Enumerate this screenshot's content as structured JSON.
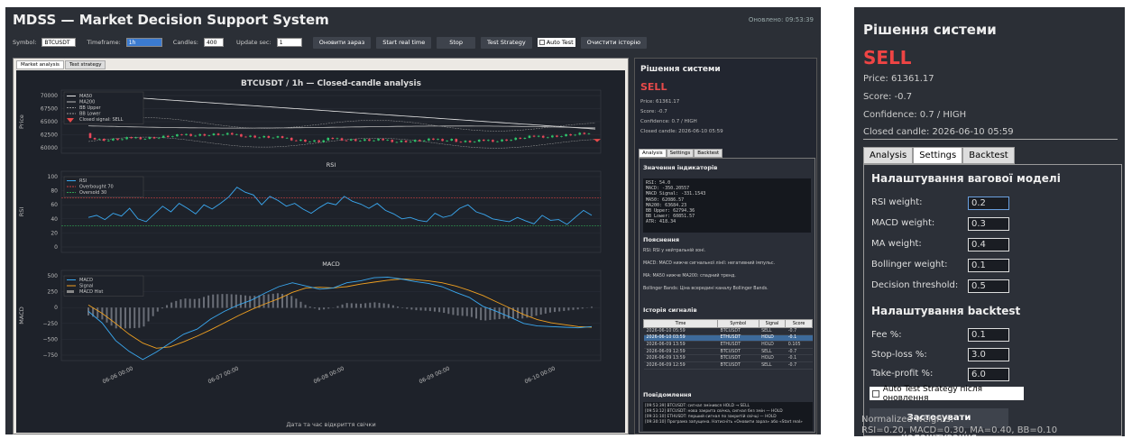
{
  "app": {
    "title": "MDSS — Market Decision Support System",
    "status": "Оновлено: 09:53:39"
  },
  "toolbar": {
    "symbol_label": "Symbol:",
    "symbol_value": "BTCUSDT",
    "timeframe_label": "Timeframe:",
    "timeframe_value": "1h",
    "candles_label": "Candles:",
    "candles_value": "400",
    "update_label": "Update sec:",
    "update_value": "1",
    "refresh_btn": "Оновити зараз",
    "start_btn": "Start real time",
    "stop_btn": "Stop",
    "test_btn": "Test Strategy",
    "auto_test": "Auto Test",
    "clear_btn": "Очистити історію"
  },
  "left_tabs": [
    "Market analysis",
    "Test strategy"
  ],
  "chart_data": [
    {
      "type": "line",
      "title": "BTCUSDT / 1h — Closed-candle analysis",
      "ylabel": "Price",
      "ylim": [
        59000,
        71500
      ],
      "yticks": [
        "70000",
        "67500",
        "65000",
        "62500",
        "60000"
      ],
      "legend": [
        "MA50",
        "MA200",
        "BB Upper",
        "BB Lower",
        "Closed signal: SELL"
      ],
      "legend_position": "top-left"
    },
    {
      "type": "line",
      "title": "RSI",
      "ylabel": "RSI",
      "ylim": [
        0,
        100
      ],
      "yticks": [
        "100",
        "80",
        "60",
        "40",
        "20",
        "0"
      ],
      "legend": [
        "RSI",
        "Overbought 70",
        "Oversold 30"
      ],
      "series": [
        {
          "name": "RSI",
          "values": [
            42,
            45,
            39,
            48,
            44,
            55,
            40,
            36,
            47,
            58,
            50,
            62,
            55,
            47,
            60,
            54,
            62,
            71,
            85,
            78,
            74,
            60,
            72,
            66,
            58,
            62,
            54,
            48,
            56,
            63,
            60,
            72,
            65,
            61,
            55,
            62,
            52,
            47,
            40,
            42,
            38,
            36,
            48,
            42,
            45,
            55,
            60,
            50,
            46,
            40,
            38,
            36,
            42,
            37,
            33,
            45,
            38,
            39,
            32,
            42,
            52,
            45
          ]
        }
      ]
    },
    {
      "type": "line",
      "title": "MACD",
      "ylabel": "MACD",
      "xlabel": "Дата та час відкриття свічки",
      "ylim": [
        -900,
        600
      ],
      "yticks": [
        "500",
        "250",
        "0",
        "−250",
        "−500",
        "−750"
      ],
      "xticks": [
        "06-06 00:00",
        "06-07 00:00",
        "06-08 00:00",
        "06-09 00:00",
        "06-10 00:00"
      ],
      "legend": [
        "MACD",
        "Signal",
        "MACD Hist"
      ],
      "series": [
        {
          "name": "MACD",
          "values": [
            -60,
            -240,
            -520,
            -690,
            -820,
            -700,
            -560,
            -420,
            -340,
            -180,
            -60,
            40,
            120,
            230,
            330,
            390,
            340,
            290,
            310,
            390,
            420,
            470,
            480,
            450,
            410,
            380,
            330,
            240,
            160,
            20,
            -60,
            -150,
            -250,
            -290,
            -300,
            -310,
            -320,
            -300
          ]
        },
        {
          "name": "Signal",
          "values": [
            40,
            -90,
            -250,
            -420,
            -560,
            -640,
            -620,
            -540,
            -450,
            -350,
            -240,
            -130,
            -30,
            60,
            140,
            240,
            310,
            320,
            310,
            330,
            370,
            400,
            430,
            450,
            440,
            420,
            390,
            340,
            270,
            190,
            90,
            -10,
            -110,
            -190,
            -240,
            -270,
            -300,
            -310
          ]
        }
      ]
    }
  ],
  "decision": {
    "header": "Рішення системи",
    "signal": "SELL",
    "price": "Price: 61361.17",
    "score": "Score: -0.7",
    "confidence": "Confidence: 0.7 / HIGH",
    "closed": "Closed candle: 2026-06-10 05:59"
  },
  "right_tabs": [
    "Analysis",
    "Settings",
    "Backtest"
  ],
  "analysis": {
    "indicators_title": "Значення індикаторів",
    "indicators": "RSI: 54.0\nMACD: -350.20557\nMACD Signal: -331.1543\nMA50: 62086.57\nMA200: 63684.23\nBB Upper: 62794.36\nBB Lower: 60851.57\nATR: 418.34",
    "explain_title": "Пояснення",
    "explain": [
      "RSI: RSI у нейтральній зоні.",
      "MACD: MACD нижче сигнальної лінії: негативний імпульс.",
      "MA: MA50 нижче MA200: спадний тренд.",
      "Bollinger Bands: Ціна всередині каналу Bollinger Bands."
    ],
    "history_title": "Історія сигналів",
    "history_headers": [
      "Time",
      "Symbol",
      "Signal",
      "Score"
    ],
    "history": [
      [
        "2026-06-10 05:59",
        "BTCUSDT",
        "SELL",
        "-0.7"
      ],
      [
        "2026-06-10 03:59",
        "ETHUSDT",
        "HOLD",
        "-0.1"
      ],
      [
        "2026-06-09 13:59",
        "ETHUSDT",
        "HOLD",
        "0.105"
      ],
      [
        "2026-06-09 12:59",
        "BTCUSDT",
        "SELL",
        "-0.7"
      ],
      [
        "2026-06-09 13:59",
        "BTCUSDT",
        "HOLD",
        "-0.1"
      ],
      [
        "2026-06-09 12:59",
        "BTCUSDT",
        "SELL",
        "-0.7"
      ]
    ],
    "messages_title": "Повідомлення",
    "messages": [
      "[09:53:39] BTCUSDT: сигнал змінився HOLD → SELL",
      "[09:53:12] BTCUSDT: нова закрита свічка, сигнал без змін — HOLD",
      "[09:31:10] ETHUSDT: перший сигнал по закритій свічці — HOLD",
      "[09:30:10] Програма запущена. Натисніть «Оновити зараз» або «Start real»"
    ]
  },
  "settings": {
    "weights_title": "Налаштування вагової моделі",
    "rsi_label": "RSI weight:",
    "rsi": "0.2",
    "macd_label": "MACD weight:",
    "macd": "0.3",
    "ma_label": "MA weight:",
    "ma": "0.4",
    "bb_label": "Bollinger weight:",
    "bb": "0.1",
    "thr_label": "Decision threshold:",
    "thr": "0.5",
    "backtest_title": "Налаштування backtest",
    "fee_label": "Fee %:",
    "fee": "0.1",
    "sl_label": "Stop-loss %:",
    "sl": "3.0",
    "tp_label": "Take-profit %:",
    "tp": "6.0",
    "auto_label": "Auto Test Strategy після оновлення",
    "apply_btn": "Застосувати налаштування",
    "norm_title": "Normalized weights:",
    "norm_values": "RSI=0.20, MACD=0.30, MA=0.40, BB=0.10"
  },
  "colors": {
    "sell": "#e84a4a",
    "rsi": "#3aa8f0",
    "signal": "#f0a020",
    "macd": "#3aa8f0",
    "up": "#2ec46a",
    "down": "#e8485a"
  }
}
